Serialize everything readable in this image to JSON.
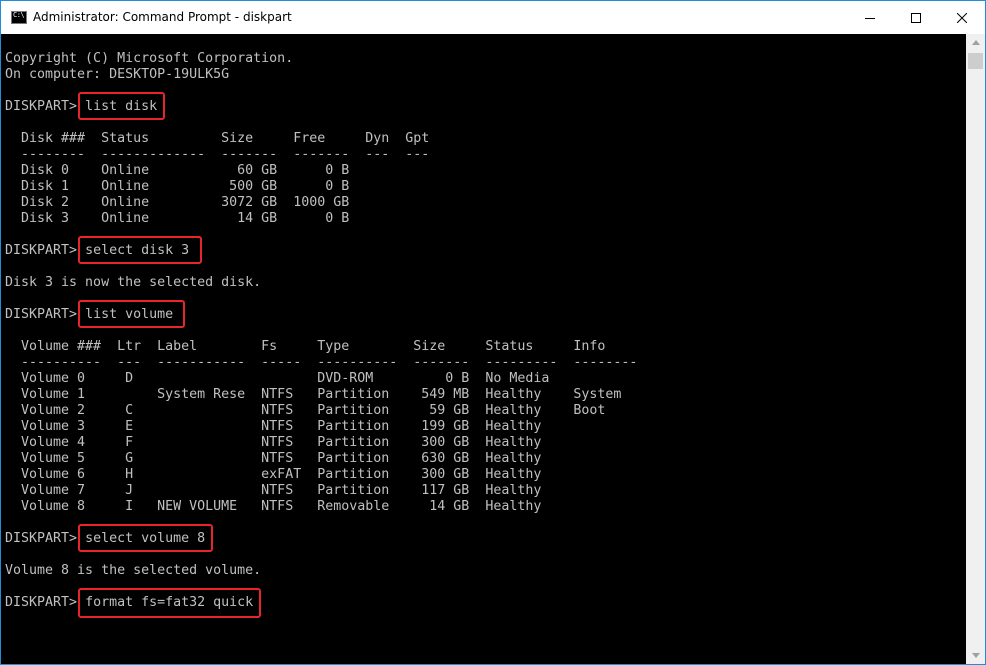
{
  "window": {
    "title": "Administrator: Command Prompt - diskpart"
  },
  "titlebar": {
    "icon": "cmd-icon",
    "controls": [
      "minimize-icon",
      "maximize-icon",
      "close-icon"
    ]
  },
  "colors": {
    "console_bg": "#000000",
    "console_text": "#c0c0c0",
    "highlight": "#e8262a"
  },
  "console": {
    "copyright": "Copyright (C) Microsoft Corporation.",
    "computer": "On computer: DESKTOP-19ULK5G",
    "prompt": "DISKPART> ",
    "commands": [
      "list disk",
      "select disk 3",
      "list volume",
      "select volume 8",
      "format fs=fat32 quick"
    ],
    "disk_table": {
      "header": "  Disk ###  Status         Size     Free     Dyn  Gpt",
      "separator": "  --------  -------------  -------  -------  ---  ---",
      "rows": [
        "  Disk 0    Online           60 GB      0 B",
        "  Disk 1    Online          500 GB      0 B",
        "  Disk 2    Online         3072 GB  1000 GB",
        "  Disk 3    Online           14 GB      0 B"
      ]
    },
    "disk_selected_msg": "Disk 3 is now the selected disk.",
    "volume_table": {
      "header": "  Volume ###  Ltr  Label        Fs     Type        Size     Status     Info",
      "separator": "  ----------  ---  -----------  -----  ----------  -------  ---------  --------",
      "rows": [
        "  Volume 0     D                       DVD-ROM         0 B  No Media",
        "  Volume 1         System Rese  NTFS   Partition    549 MB  Healthy    System",
        "  Volume 2     C                NTFS   Partition     59 GB  Healthy    Boot",
        "  Volume 3     E                NTFS   Partition    199 GB  Healthy",
        "  Volume 4     F                NTFS   Partition    300 GB  Healthy",
        "  Volume 5     G                NTFS   Partition    630 GB  Healthy",
        "  Volume 6     H                exFAT  Partition    300 GB  Healthy",
        "  Volume 7     J                NTFS   Partition    117 GB  Healthy",
        "  Volume 8     I   NEW VOLUME   NTFS   Removable     14 GB  Healthy"
      ]
    },
    "volume_selected_msg": "Volume 8 is the selected volume."
  }
}
